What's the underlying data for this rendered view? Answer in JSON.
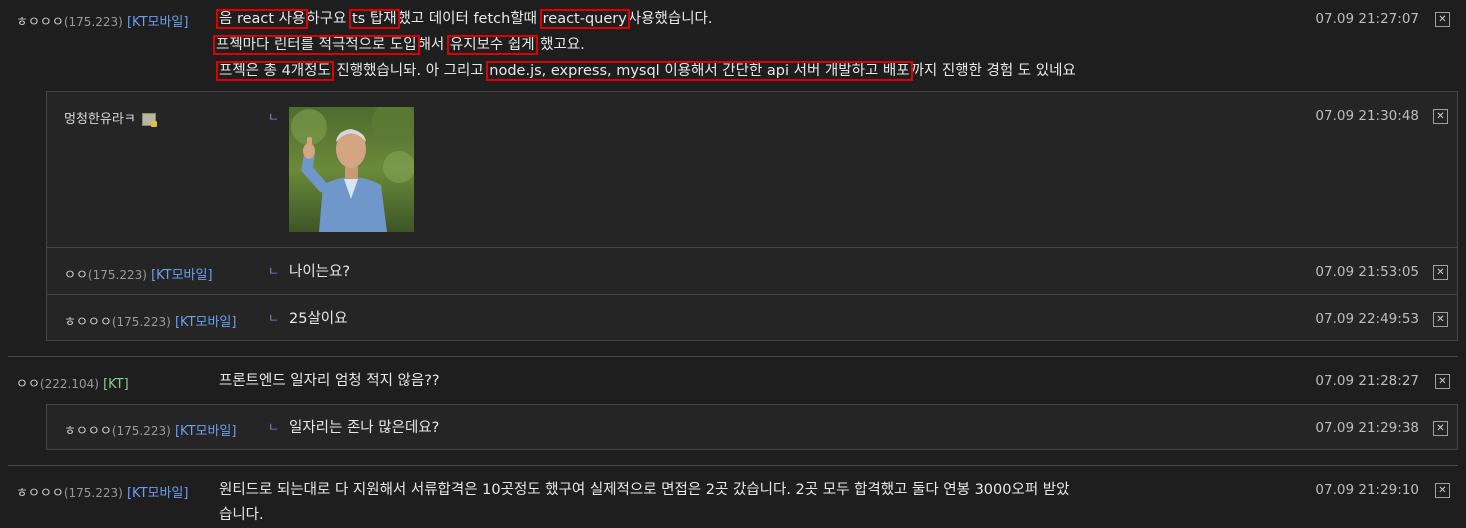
{
  "comments": [
    {
      "nick": "ㅎㅇㅇㅇ",
      "ip": "(175.223)",
      "isp": "[KT모바일]",
      "date": "07.09 21:27:07",
      "lines": {
        "l1": {
          "s1": "음 react 사용",
          "s2": "하구요 ",
          "s3": "ts 탑재",
          "s4": "했고 데이터 fetch할때 ",
          "s5": "react-query",
          "s6": "사용했습니다."
        },
        "l2": {
          "s1": "프젝마다 린터를 적극적으로 도입",
          "s2": "해서 ",
          "s3": "유지보수 쉽게",
          "s4": " 했고요."
        },
        "l3": {
          "s1": "프젝은 총 4개정도",
          "s2": " 진행했습니돠. 아 그리고 ",
          "s3": "node.js, express, mysql 이용해서 간단한 api 서버 개발하고 배포",
          "s4": "까지 진행한 경험 도 있네요"
        }
      },
      "replies": [
        {
          "nick": "멍청한유라ㅋ",
          "date": "07.09 21:30:48",
          "image": "thumbs-up-photo"
        },
        {
          "nick": "ㅇㅇ",
          "ip": "(175.223)",
          "isp": "[KT모바일]",
          "text": "나이는요?",
          "date": "07.09 21:53:05"
        },
        {
          "nick": "ㅎㅇㅇㅇ",
          "ip": "(175.223)",
          "isp": "[KT모바일]",
          "text": "25살이요",
          "date": "07.09 22:49:53"
        }
      ]
    },
    {
      "nick": "ㅇㅇ",
      "ip": "(222.104)",
      "isp": "[KT]",
      "text": "프론트엔드 일자리 엄청 적지 않음??",
      "date": "07.09 21:28:27",
      "replies": [
        {
          "nick": "ㅎㅇㅇㅇ",
          "ip": "(175.223)",
          "isp": "[KT모바일]",
          "text": "일자리는 존나 많은데요?",
          "date": "07.09 21:29:38"
        }
      ]
    },
    {
      "nick": "ㅎㅇㅇㅇ",
      "ip": "(175.223)",
      "isp": "[KT모바일]",
      "line1": "원티드로 되는대로 다 지원해서 서류합격은 10곳정도 했구여 실제적으로 면접은 2곳 갔습니다. 2곳 모두 합격했고 둘다 연봉 3000오퍼 받았",
      "line2": "습니다.",
      "date": "07.09 21:29:10"
    }
  ],
  "ui": {
    "delete_glyph": "✕",
    "reply_arrow": "ㄴ",
    "highlight_color": "#e00000"
  }
}
